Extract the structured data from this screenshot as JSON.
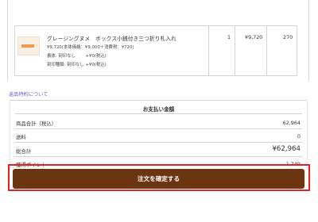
{
  "order_item": {
    "name": "グレージングヌメ　ボックス小銭付き三つ折り札入れ",
    "price_detail": "¥9,720(本体価格：¥9,000＋消費税：¥720)",
    "option_1": "書体: 刻印なし　　 +¥0(税込)",
    "option_2": "刻印種類: 刻印なし +¥0(税込)",
    "quantity": "1",
    "unit_price": "¥9,720",
    "points": "270"
  },
  "returns_link": "返品特約について",
  "payment_summary": {
    "title": "お支払い金額",
    "rows": [
      {
        "label": "商品合計（税込）",
        "value": "62,964"
      },
      {
        "label": "送料",
        "value": "0"
      },
      {
        "label": "総合計",
        "value": "¥62,964"
      },
      {
        "label": "獲得ポイント",
        "value": "1,749"
      }
    ]
  },
  "confirm_button": "注文を確定する",
  "colors": {
    "cta_background": "#6b3512",
    "highlight_border": "#e8201c",
    "link": "#6b5cc5",
    "thumbnail_accent": "#ef9a52"
  }
}
